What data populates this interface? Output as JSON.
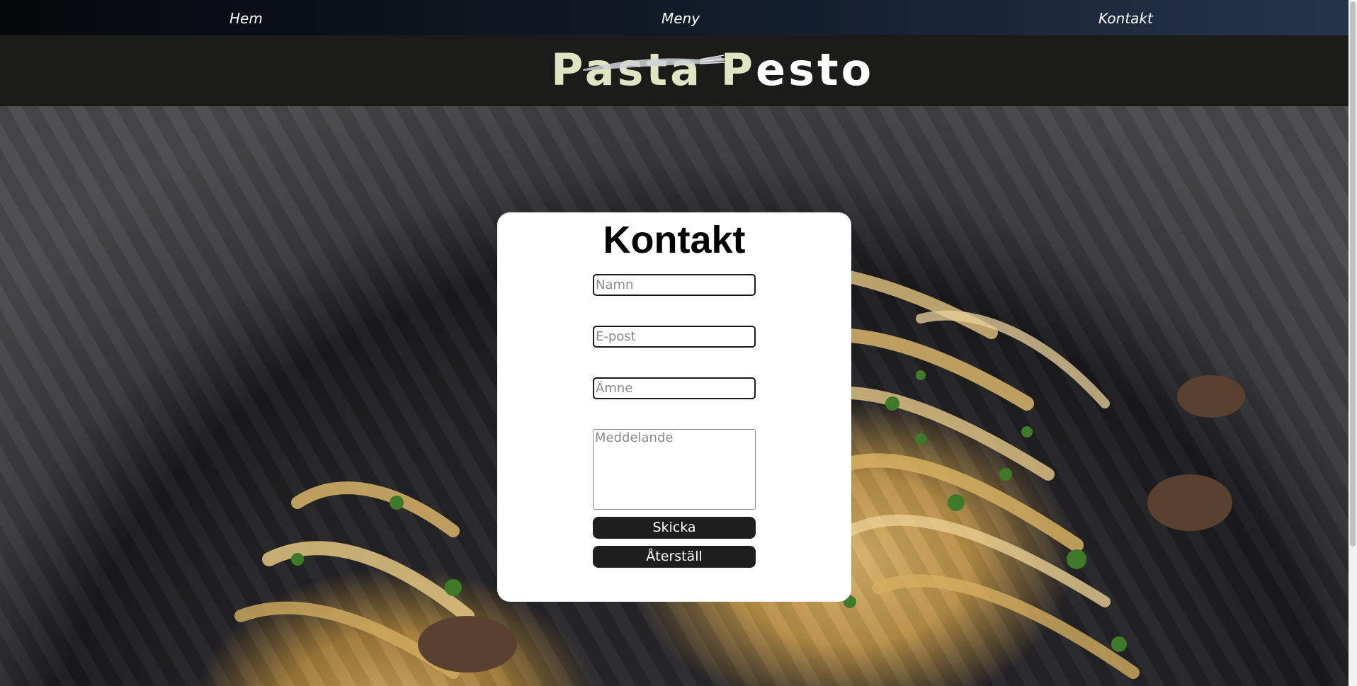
{
  "nav": {
    "items": [
      {
        "label": "Hem"
      },
      {
        "label": "Meny"
      },
      {
        "label": "Kontakt"
      }
    ]
  },
  "logo": {
    "word1": "Pasta",
    "word2_first": "P",
    "word2_rest": "esto",
    "colors": {
      "word1": "#dfe4c2",
      "word2": "#ffffff"
    }
  },
  "contact": {
    "title": "Kontakt",
    "fields": {
      "name_placeholder": "Namn",
      "email_placeholder": "E-post",
      "subject_placeholder": "Ämne",
      "message_placeholder": "Meddelande"
    },
    "submit_label": "Skicka",
    "reset_label": "Återställ"
  },
  "colors": {
    "nav_bg_start": "#06080b",
    "nav_bg_end": "#25344b",
    "logo_bar_bg": "#1b1b1a",
    "button_bg": "#1e1e1e"
  }
}
